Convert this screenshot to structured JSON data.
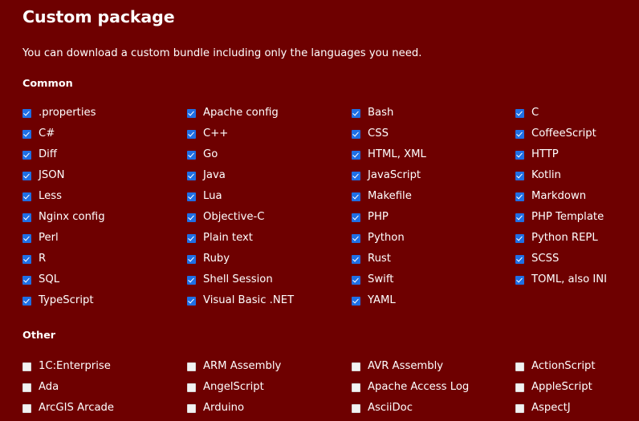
{
  "page": {
    "title": "Custom package",
    "intro": "You can download a custom bundle including only the languages you need.",
    "background_color": "#6e0000",
    "checkbox_checked_color": "#1f6fe5",
    "checkbox_unchecked_color": "#f2f2f2",
    "text_color": "#ffffff"
  },
  "sections": [
    {
      "id": "common",
      "heading": "Common",
      "columns": [
        [
          {
            "label": ".properties",
            "checked": true
          },
          {
            "label": "C#",
            "checked": true
          },
          {
            "label": "Diff",
            "checked": true
          },
          {
            "label": "JSON",
            "checked": true
          },
          {
            "label": "Less",
            "checked": true
          },
          {
            "label": "Nginx config",
            "checked": true
          },
          {
            "label": "Perl",
            "checked": true
          },
          {
            "label": "R",
            "checked": true
          },
          {
            "label": "SQL",
            "checked": true
          },
          {
            "label": "TypeScript",
            "checked": true
          }
        ],
        [
          {
            "label": "Apache config",
            "checked": true
          },
          {
            "label": "C++",
            "checked": true
          },
          {
            "label": "Go",
            "checked": true
          },
          {
            "label": "Java",
            "checked": true
          },
          {
            "label": "Lua",
            "checked": true
          },
          {
            "label": "Objective-C",
            "checked": true
          },
          {
            "label": "Plain text",
            "checked": true
          },
          {
            "label": "Ruby",
            "checked": true
          },
          {
            "label": "Shell Session",
            "checked": true
          },
          {
            "label": "Visual Basic .NET",
            "checked": true
          }
        ],
        [
          {
            "label": "Bash",
            "checked": true
          },
          {
            "label": "CSS",
            "checked": true
          },
          {
            "label": "HTML, XML",
            "checked": true
          },
          {
            "label": "JavaScript",
            "checked": true
          },
          {
            "label": "Makefile",
            "checked": true
          },
          {
            "label": "PHP",
            "checked": true
          },
          {
            "label": "Python",
            "checked": true
          },
          {
            "label": "Rust",
            "checked": true
          },
          {
            "label": "Swift",
            "checked": true
          },
          {
            "label": "YAML",
            "checked": true
          }
        ],
        [
          {
            "label": "C",
            "checked": true
          },
          {
            "label": "CoffeeScript",
            "checked": true
          },
          {
            "label": "HTTP",
            "checked": true
          },
          {
            "label": "Kotlin",
            "checked": true
          },
          {
            "label": "Markdown",
            "checked": true
          },
          {
            "label": "PHP Template",
            "checked": true
          },
          {
            "label": "Python REPL",
            "checked": true
          },
          {
            "label": "SCSS",
            "checked": true
          },
          {
            "label": "TOML, also INI",
            "checked": true
          }
        ]
      ]
    },
    {
      "id": "other",
      "heading": "Other",
      "columns": [
        [
          {
            "label": "1C:Enterprise",
            "checked": false
          },
          {
            "label": "Ada",
            "checked": false
          },
          {
            "label": "ArcGIS Arcade",
            "checked": false
          }
        ],
        [
          {
            "label": "ARM Assembly",
            "checked": false
          },
          {
            "label": "AngelScript",
            "checked": false
          },
          {
            "label": "Arduino",
            "checked": false
          }
        ],
        [
          {
            "label": "AVR Assembly",
            "checked": false
          },
          {
            "label": "Apache Access Log",
            "checked": false
          },
          {
            "label": "AsciiDoc",
            "checked": false
          }
        ],
        [
          {
            "label": "ActionScript",
            "checked": false
          },
          {
            "label": "AppleScript",
            "checked": false
          },
          {
            "label": "AspectJ",
            "checked": false
          }
        ]
      ]
    }
  ]
}
